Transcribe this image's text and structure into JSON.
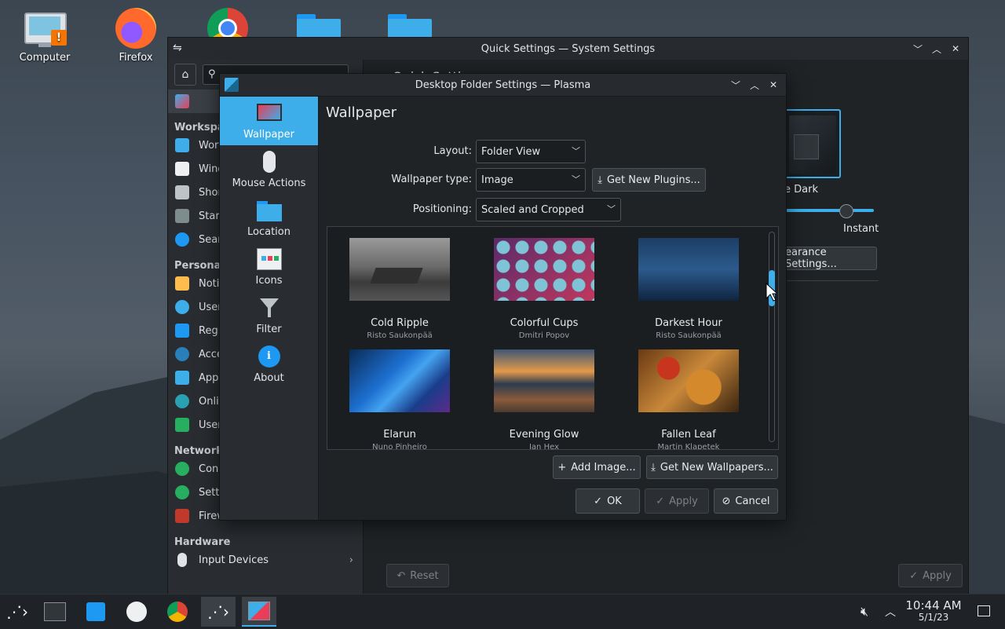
{
  "desktop": {
    "icons": [
      {
        "label": "Computer"
      },
      {
        "label": "Firefox"
      },
      {
        "label": ""
      },
      {
        "label": ""
      },
      {
        "label": ""
      }
    ]
  },
  "system_settings": {
    "title": "Quick Settings — System Settings",
    "sidebar": {
      "sections": [
        {
          "header": "Workspace",
          "items": [
            "Work",
            "Wind",
            "Shor",
            "Start",
            "Sear"
          ]
        },
        {
          "header": "Personal",
          "items": [
            "Notif",
            "User",
            "Regio",
            "Acce",
            "Appl",
            "Onlin",
            "User"
          ]
        },
        {
          "header": "Network",
          "items": [
            "Conn",
            "Setti",
            "Firewall"
          ]
        },
        {
          "header": "Hardware",
          "items": [
            "Input Devices"
          ]
        }
      ]
    },
    "theme_label": "e Dark",
    "animation_label": "Instant",
    "appearance_button": "earance Settings...",
    "reset_button": "Reset",
    "apply_button": "Apply",
    "heading_fragment": "Quick Setti"
  },
  "dialog": {
    "title": "Desktop Folder Settings — Plasma",
    "sidebar": [
      {
        "label": "Wallpaper",
        "active": true
      },
      {
        "label": "Mouse Actions"
      },
      {
        "label": "Location"
      },
      {
        "label": "Icons"
      },
      {
        "label": "Filter"
      },
      {
        "label": "About"
      }
    ],
    "heading": "Wallpaper",
    "layout_label": "Layout:",
    "layout_value": "Folder View",
    "wallpaper_type_label": "Wallpaper type:",
    "wallpaper_type_value": "Image",
    "get_plugins": "Get New Plugins...",
    "positioning_label": "Positioning:",
    "positioning_value": "Scaled and Cropped",
    "wallpapers": [
      {
        "name": "Cold Ripple",
        "author": "Risto Saukonpää"
      },
      {
        "name": "Colorful Cups",
        "author": "Dmitri Popov"
      },
      {
        "name": "Darkest Hour",
        "author": "Risto Saukonpää"
      },
      {
        "name": "Elarun",
        "author": "Nuno Pinheiro"
      },
      {
        "name": "Evening Glow",
        "author": "Ian Hex"
      },
      {
        "name": "Fallen Leaf",
        "author": "Martin Klapetek"
      }
    ],
    "add_image": "Add Image...",
    "get_wallpapers": "Get New Wallpapers...",
    "ok": "OK",
    "apply": "Apply",
    "cancel": "Cancel"
  },
  "taskbar": {
    "time": "10:44 AM",
    "date": "5/1/23"
  },
  "colors": {
    "accent": "#3daee9",
    "window_bg": "#202326",
    "sidebar_bg": "#292c30"
  }
}
